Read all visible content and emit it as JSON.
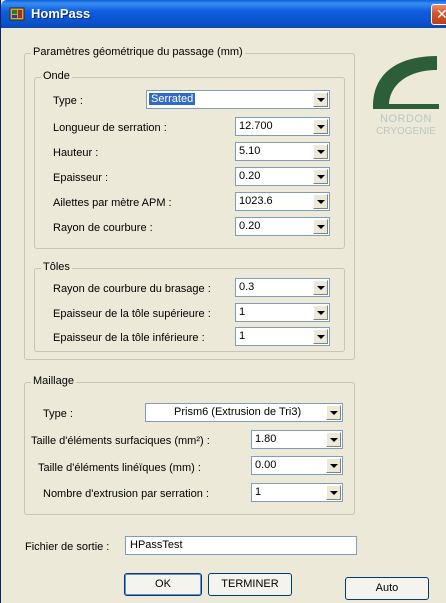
{
  "window": {
    "title": "HomPass"
  },
  "geometry": {
    "title": "Paramètres géométrique du passage (mm)",
    "onde": {
      "title": "Onde",
      "type_label": "Type :",
      "type_value": "Serrated",
      "longueur_label": "Longueur de serration :",
      "longueur_value": "12.700",
      "hauteur_label": "Hauteur :",
      "hauteur_value": "5.10",
      "epaisseur_label": "Epaisseur :",
      "epaisseur_value": "0.20",
      "ailettes_label": "Ailettes par mètre APM :",
      "ailettes_value": "1023.6",
      "rayon_label": "Rayon de courbure :",
      "rayon_value": "0.20"
    },
    "toles": {
      "title": "Tôles",
      "brasage_label": "Rayon de courbure du brasage :",
      "brasage_value": "0.3",
      "sup_label": "Epaisseur de la tôle supérieure :",
      "sup_value": "1",
      "inf_label": "Epaisseur de la tôle inférieure :",
      "inf_value": "1"
    }
  },
  "maillage": {
    "title": "Maillage",
    "type_label": "Type :",
    "type_value": "Prism6 (Extrusion de Tri3)",
    "surf_label": "Taille d'éléments surfaciques (mm²) :",
    "surf_value": "1.80",
    "lin_label": "Taille d'éléments linéïques (mm) :",
    "lin_value": "0.00",
    "extr_label": "Nombre d'extrusion par serration :",
    "extr_value": "1"
  },
  "output": {
    "label": "Fichier de sortie :",
    "value": "HPassTest"
  },
  "buttons": {
    "ok": "OK",
    "terminer": "TERMINER",
    "auto": "Auto"
  },
  "logo": {
    "line1": "NORDON",
    "line2": "CRYOGENIE",
    "color": "#2c5e3a"
  },
  "colors": {
    "titlebar": "#0b52cc",
    "selection": "#316ac5",
    "dialog_bg": "#ece9d8"
  }
}
